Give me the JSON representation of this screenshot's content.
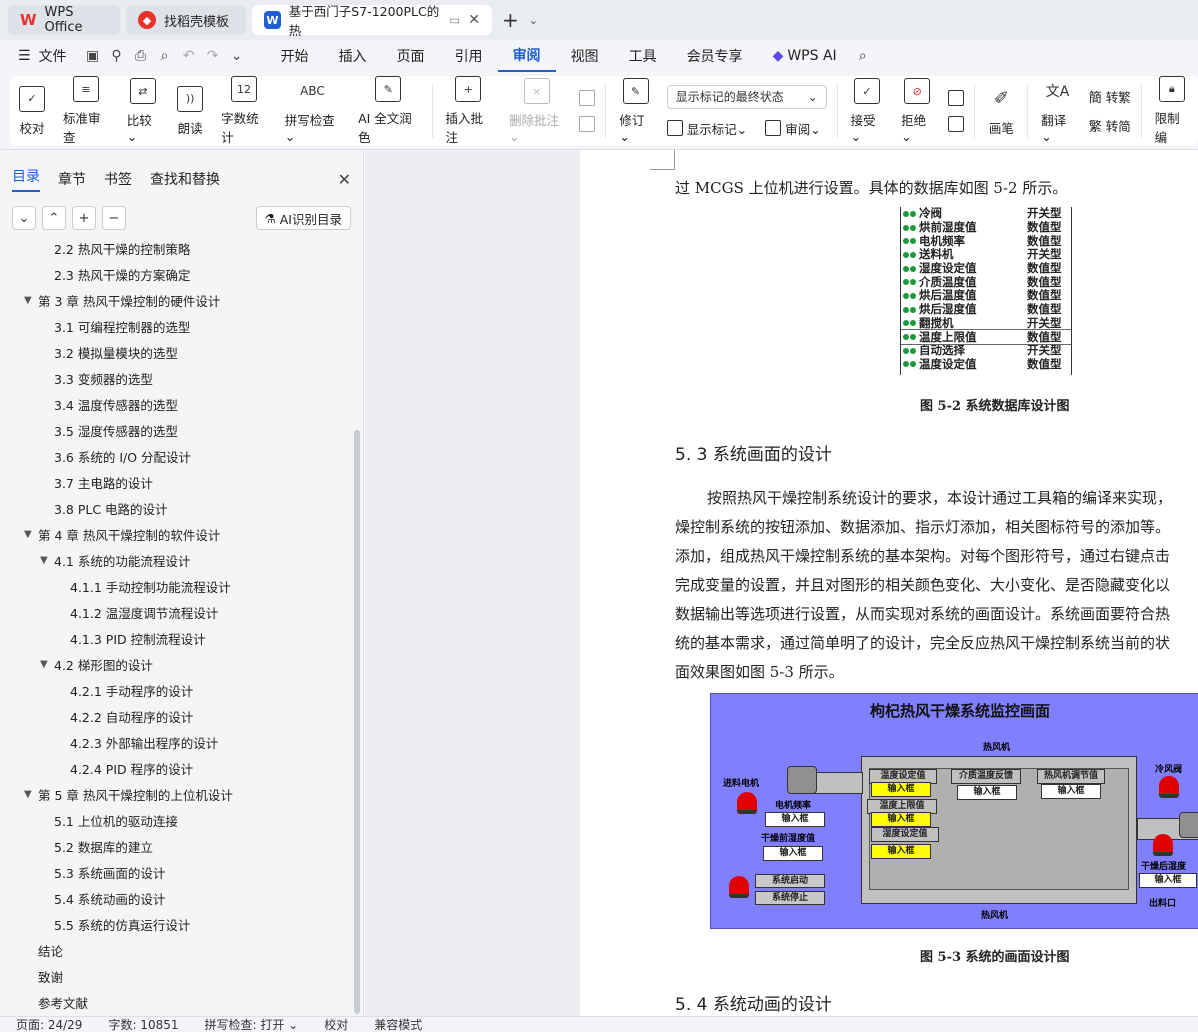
{
  "tabs": [
    {
      "label": "WPS Office",
      "icon": "wps-logo-icon",
      "color": "#e8322a"
    },
    {
      "label": "找稻壳模板",
      "icon": "docer-icon",
      "color": "#e8322a"
    },
    {
      "label": "基于西门子S7-1200PLC的热",
      "icon": "word-doc-icon",
      "color": "#1f5fd6"
    }
  ],
  "menu": {
    "file": "文件",
    "items": [
      "开始",
      "插入",
      "页面",
      "引用",
      "审阅",
      "视图",
      "工具",
      "会员专享"
    ],
    "active": "审阅",
    "ai": "WPS AI"
  },
  "ribbon": {
    "proofread": "校对",
    "std_review": "标准审查",
    "compare": "比较",
    "read_aloud": "朗读",
    "word_count": "字数统计",
    "spell_check": "拼写检查",
    "ai_polish": "AI 全文润色",
    "insert_comment": "插入批注",
    "delete_comment": "删除批注",
    "track": "修订",
    "display_select": "显示标记的最终状态",
    "show_markup": "显示标记",
    "review": "审阅",
    "accept": "接受",
    "reject": "拒绝",
    "pen": "画笔",
    "translate": "翻译",
    "to_trad": "转繁",
    "to_simp": "转简",
    "restrict": "限制编"
  },
  "sidebar": {
    "tabs": [
      "目录",
      "章节",
      "书签",
      "查找和替换"
    ],
    "active": "目录",
    "ai_toc": "AI识别目录"
  },
  "toc": [
    {
      "text": "2.2  热风干燥的控制策略",
      "lvl": 2,
      "arrow": ""
    },
    {
      "text": "2.3  热风干燥的方案确定",
      "lvl": 2,
      "arrow": ""
    },
    {
      "text": "第 3 章  热风干燥控制的硬件设计",
      "lvl": 1,
      "arrow": "▼"
    },
    {
      "text": "3.1  可编程控制器的选型",
      "lvl": 2,
      "arrow": ""
    },
    {
      "text": "3.2  模拟量模块的选型",
      "lvl": 2,
      "arrow": ""
    },
    {
      "text": "3.3  变频器的选型",
      "lvl": 2,
      "arrow": ""
    },
    {
      "text": "3.4  温度传感器的选型",
      "lvl": 2,
      "arrow": ""
    },
    {
      "text": "3.5  湿度传感器的选型",
      "lvl": 2,
      "arrow": ""
    },
    {
      "text": "3.6  系统的 I/O 分配设计",
      "lvl": 2,
      "arrow": ""
    },
    {
      "text": "3.7  主电路的设计",
      "lvl": 2,
      "arrow": ""
    },
    {
      "text": "3.8 PLC 电路的设计",
      "lvl": 2,
      "arrow": ""
    },
    {
      "text": "第 4 章  热风干燥控制的软件设计",
      "lvl": 1,
      "arrow": "▼"
    },
    {
      "text": "4.1  系统的功能流程设计",
      "lvl": 2,
      "arrow": "▼"
    },
    {
      "text": "4.1.1  手动控制功能流程设计",
      "lvl": 3,
      "arrow": ""
    },
    {
      "text": "4.1.2  温湿度调节流程设计",
      "lvl": 3,
      "arrow": ""
    },
    {
      "text": "4.1.3 PID 控制流程设计",
      "lvl": 3,
      "arrow": ""
    },
    {
      "text": "4.2  梯形图的设计",
      "lvl": 2,
      "arrow": "▼"
    },
    {
      "text": "4.2.1  手动程序的设计",
      "lvl": 3,
      "arrow": ""
    },
    {
      "text": "4.2.2  自动程序的设计",
      "lvl": 3,
      "arrow": ""
    },
    {
      "text": "4.2.3  外部输出程序的设计",
      "lvl": 3,
      "arrow": ""
    },
    {
      "text": "4.2.4 PID 程序的设计",
      "lvl": 3,
      "arrow": ""
    },
    {
      "text": "第 5 章  热风干燥控制的上位机设计",
      "lvl": 1,
      "arrow": "▼"
    },
    {
      "text": "5.1  上位机的驱动连接",
      "lvl": 2,
      "arrow": ""
    },
    {
      "text": "5.2  数据库的建立",
      "lvl": 2,
      "arrow": ""
    },
    {
      "text": "5.3  系统画面的设计",
      "lvl": 2,
      "arrow": ""
    },
    {
      "text": "5.4  系统动画的设计",
      "lvl": 2,
      "arrow": ""
    },
    {
      "text": "5.5  系统的仿真运行设计",
      "lvl": 2,
      "arrow": ""
    },
    {
      "text": "结论",
      "lvl": 1,
      "arrow": ""
    },
    {
      "text": "致谢",
      "lvl": 1,
      "arrow": ""
    },
    {
      "text": "参考文献",
      "lvl": 1,
      "arrow": ""
    }
  ],
  "doc": {
    "line0": "过 MCGS 上位机进行设置。具体的数据库如图 5-2 所示。",
    "db": [
      [
        "冷阀",
        "开关型"
      ],
      [
        "烘前湿度值",
        "数值型"
      ],
      [
        "电机频率",
        "数值型"
      ],
      [
        "送料机",
        "开关型"
      ],
      [
        "湿度设定值",
        "数值型"
      ],
      [
        "介质温度值",
        "数值型"
      ],
      [
        "烘后温度值",
        "数值型"
      ],
      [
        "烘后湿度值",
        "数值型"
      ],
      [
        "翻搅机",
        "开关型"
      ],
      [
        "温度上限值",
        "数值型"
      ],
      [
        "自动选择",
        "开关型"
      ],
      [
        "温度设定值",
        "数值型"
      ]
    ],
    "cap1": "图 5-2  系统数据库设计图",
    "h1": "5. 3  系统画面的设计",
    "para": [
      "按照热风干燥控制系统设计的要求，本设计通过工具箱的编译来实现，",
      "燥控制系统的按钮添加、数据添加、指示灯添加，相关图标符号的添加等。",
      "添加，组成热风干燥控制系统的基本架构。对每个图形符号，通过右键点击",
      "完成变量的设置，并且对图形的相关颜色变化、大小变化、是否隐藏变化以",
      "数据输出等选项进行设置，从而实现对系统的画面设计。系统画面要符合热",
      "统的基本需求，通过简单明了的设计，完全反应热风干燥控制系统当前的状",
      "面效果图如图 5-3 所示。"
    ],
    "scada": {
      "title": "枸杞热风干燥系统监控画面",
      "hot_air_top": "热风机",
      "hot_air_bottom": "热风机",
      "feed_motor": "进料电机",
      "motor_freq": "电机频率",
      "pre_humidity": "干燥前湿度值",
      "temp_set": "温度设定值",
      "temp_upper": "温度上限值",
      "hum_set": "湿度设定值",
      "medium_temp": "介质温度反馈",
      "fan_adjust": "热风机调节值",
      "cold_valve": "冷风阀",
      "post_humidity": "干燥后湿度",
      "outlet": "出料口",
      "start": "系统启动",
      "stop": "系统停止",
      "input": "输入框"
    },
    "cap2": "图 5-3  系统的画面设计图",
    "h2": "5. 4  系统动画的设计"
  },
  "status": {
    "page": "页面: 24/29",
    "words": "字数: 10851",
    "spell": "拼写检查: 打开",
    "proof": "校对",
    "compat": "兼容模式"
  }
}
